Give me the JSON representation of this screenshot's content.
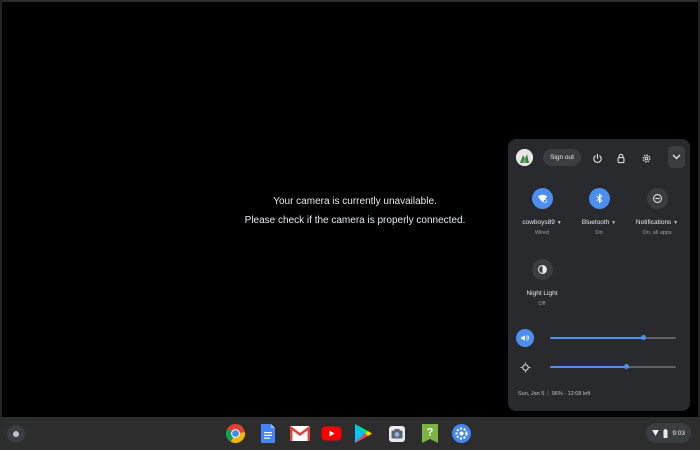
{
  "camera": {
    "line1": "Your camera is currently unavailable.",
    "line2": "Please check if the camera is properly connected."
  },
  "quick_settings": {
    "sign_out_label": "Sign out",
    "top_icons": [
      "power-icon",
      "lock-icon",
      "settings-gear-icon",
      "chevron-down-icon"
    ],
    "tiles": [
      {
        "name": "wifi",
        "label": "cowboys89",
        "sub": "Wired",
        "state": "on",
        "icon": "network-icon"
      },
      {
        "name": "bluetooth",
        "label": "Bluetooth",
        "sub": "On",
        "state": "on",
        "icon": "bluetooth-icon"
      },
      {
        "name": "notifications",
        "label": "Notifications",
        "sub": "On, all apps",
        "state": "off",
        "icon": "do-not-disturb-icon"
      },
      {
        "name": "night-light",
        "label": "Night Light",
        "sub": "Off",
        "state": "off",
        "icon": "night-light-icon"
      }
    ],
    "sliders": {
      "volume": {
        "icon": "volume-icon",
        "level": 0.74
      },
      "brightness": {
        "icon": "brightness-icon",
        "level": 0.61
      }
    },
    "footer": {
      "date": "Sun, Jan 5",
      "battery": "96% - 12:08 left"
    }
  },
  "shelf": {
    "apps": [
      "chrome-icon",
      "docs-icon",
      "gmail-icon",
      "youtube-icon",
      "play-store-icon",
      "camera-app-icon",
      "help-icon",
      "settings-app-icon"
    ],
    "status": {
      "time": "9:03"
    }
  },
  "colors": {
    "accent": "#4d8ff0",
    "panel": "#292a2d",
    "shelf": "#2d2d2d"
  }
}
